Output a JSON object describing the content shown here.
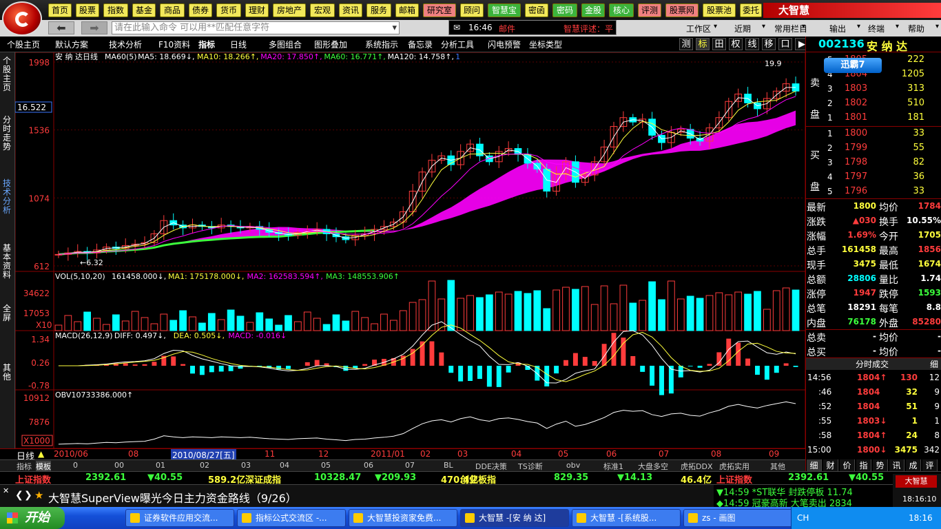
{
  "colors": {
    "red": "#ff3c3c",
    "green": "#3cff3c",
    "yellow": "#ffff3c",
    "white": "#ffffff",
    "cyan": "#00ffff",
    "magenta": "#ff00ff",
    "grid": "#8b0000"
  },
  "nav_buttons": [
    {
      "label": "首页",
      "bg": "#f2e85a",
      "fg": "#000"
    },
    {
      "label": "股票",
      "bg": "#f2e85a",
      "fg": "#000"
    },
    {
      "label": "指数",
      "bg": "#f2e85a",
      "fg": "#000"
    },
    {
      "label": "基金",
      "bg": "#f2e85a",
      "fg": "#000"
    },
    {
      "label": "商品",
      "bg": "#f2e85a",
      "fg": "#000"
    },
    {
      "label": "债券",
      "bg": "#f2e85a",
      "fg": "#000"
    },
    {
      "label": "货币",
      "bg": "#f2e85a",
      "fg": "#000"
    },
    {
      "label": "理财",
      "bg": "#f2e85a",
      "fg": "#000"
    },
    {
      "label": "房地产",
      "bg": "#f2e85a",
      "fg": "#000"
    },
    {
      "label": "宏观",
      "bg": "#f2e85a",
      "fg": "#000"
    },
    {
      "label": "资讯",
      "bg": "#f2e85a",
      "fg": "#000"
    },
    {
      "label": "服务",
      "bg": "#f2e85a",
      "fg": "#000"
    },
    {
      "label": "邮箱",
      "bg": "#f2e85a",
      "fg": "#000"
    },
    {
      "label": "研究室",
      "bg": "#f08080",
      "fg": "#000"
    },
    {
      "label": "顾问",
      "bg": "#f2e85a",
      "fg": "#000"
    },
    {
      "label": "智慧宝",
      "bg": "#3cb43c",
      "fg": "#fff"
    },
    {
      "label": "密函",
      "bg": "#f2e85a",
      "fg": "#000"
    },
    {
      "label": "密码",
      "bg": "#3cb43c",
      "fg": "#fff"
    },
    {
      "label": "金股",
      "bg": "#3cb43c",
      "fg": "#fff"
    },
    {
      "label": "核心",
      "bg": "#3cb43c",
      "fg": "#fff"
    },
    {
      "label": "评测",
      "bg": "#f08080",
      "fg": "#000"
    },
    {
      "label": "股票网",
      "bg": "#f08080",
      "fg": "#000"
    },
    {
      "label": "股票池",
      "bg": "#f2e85a",
      "fg": "#000"
    },
    {
      "label": "委托",
      "bg": "#f2e85a",
      "fg": "#000"
    }
  ],
  "brand": "大智慧",
  "command_placeholder": "请在此输入命令  可以用**匹配任意字符",
  "ticker": {
    "time": "16:46",
    "label": "邮件",
    "message": "智慧评述：平"
  },
  "right_menus": [
    "工作区",
    "近期",
    "常用栏目",
    "输出",
    "终端",
    "帮助"
  ],
  "toolbar": [
    "个股主页",
    "默认方案",
    "技术分析",
    "F10资料",
    "指标",
    "日线",
    "多图组合",
    "图形叠加",
    "系统指示",
    "备忘录",
    "分析工具",
    "闪电预警",
    "坐标类型"
  ],
  "toolbar_right": [
    "测",
    "标",
    "田",
    "权",
    "线",
    "移",
    "口",
    "▶"
  ],
  "left_tabs": [
    "个股主页",
    "分时走势",
    "技术分析",
    "基本资料",
    "全屏",
    "其他"
  ],
  "stock": {
    "code": "002136",
    "name": "安 纳 达"
  },
  "main_chart": {
    "title": "安 纳 达日线",
    "legend": [
      {
        "text": "MA60(5)",
        "color": "#fff"
      },
      {
        "text": "MA5: 18.669↓,",
        "color": "#fff"
      },
      {
        "text": "MA10: 18.266↑,",
        "color": "#ffff3c"
      },
      {
        "text": "MA20: 17.850↑,",
        "color": "#ff00ff"
      },
      {
        "text": "MA60: 16.771↑,",
        "color": "#3cff3c"
      },
      {
        "text": "MA120: 14.758↑,",
        "color": "#fff"
      },
      {
        "text": "1",
        "color": "#3c78ff"
      }
    ],
    "y_labels": [
      "1998",
      "1536",
      "1074",
      "612"
    ],
    "current_label": "16.522",
    "low_label": "6.32",
    "high_label": "19.9"
  },
  "vol_chart": {
    "legend": [
      {
        "text": "VOL(5,10,20)",
        "color": "#fff"
      },
      {
        "text": "161458.000↓,",
        "color": "#fff"
      },
      {
        "text": "MA1: 175178.000↓,",
        "color": "#ffff3c"
      },
      {
        "text": "MA2: 162583.594↑,",
        "color": "#ff00ff"
      },
      {
        "text": "MA3: 148553.906↑",
        "color": "#3cff3c"
      }
    ],
    "y_labels": [
      "34622",
      "17053"
    ],
    "unit": "X10"
  },
  "macd_chart": {
    "legend": [
      {
        "text": "MACD(26,12,9)",
        "color": "#fff"
      },
      {
        "text": "DIFF: 0.497↓,",
        "color": "#fff"
      },
      {
        "text": "DEA: 0.505↓,",
        "color": "#ffff3c"
      },
      {
        "text": "MACD: -0.016↓",
        "color": "#ff00ff"
      }
    ],
    "y_labels": [
      "1.34",
      "0.26",
      "-0.78"
    ]
  },
  "obv_chart": {
    "legend": [
      {
        "text": "OBV",
        "color": "#fff"
      },
      {
        "text": "10733386.000↑",
        "color": "#fff"
      }
    ],
    "y_labels": [
      "10912",
      "7876"
    ],
    "unit": "X1000"
  },
  "time_axis": {
    "label": "日线",
    "items": [
      "2010/06",
      "08",
      "2010/08/27[五]",
      "11",
      "12",
      "2011/01",
      "02",
      "03",
      "04",
      "05",
      "06",
      "07",
      "08",
      "09"
    ]
  },
  "bottom_tabs": [
    "指标",
    "模板",
    "0",
    "00",
    "01",
    "02",
    "03",
    "04",
    "05",
    "06",
    "07",
    "BL",
    "DDE决策",
    "TS诊断",
    "obv",
    "标准1",
    "大盘多空",
    "虎拓DDX",
    "虎拓实用",
    "其他"
  ],
  "order_book": {
    "sell_label": "卖盘",
    "buy_label": "买盘",
    "app_label": "迅霸7",
    "sell": [
      {
        "n": "5",
        "price": "1805",
        "vol": "222"
      },
      {
        "n": "4",
        "price": "1804",
        "vol": "1205"
      },
      {
        "n": "3",
        "price": "1803",
        "vol": "313"
      },
      {
        "n": "2",
        "price": "1802",
        "vol": "510"
      },
      {
        "n": "1",
        "price": "1801",
        "vol": "181"
      }
    ],
    "buy": [
      {
        "n": "1",
        "price": "1800",
        "vol": "33"
      },
      {
        "n": "2",
        "price": "1799",
        "vol": "55"
      },
      {
        "n": "3",
        "price": "1798",
        "vol": "82"
      },
      {
        "n": "4",
        "price": "1797",
        "vol": "36"
      },
      {
        "n": "5",
        "price": "1796",
        "vol": "33"
      }
    ]
  },
  "quote": [
    {
      "l1": "最新",
      "v1": "1800",
      "c1": "#ffff3c",
      "l2": "均价",
      "v2": "1784",
      "c2": "#ff3c3c"
    },
    {
      "l1": "涨跌",
      "v1": "▲030",
      "c1": "#ff3c3c",
      "l2": "换手",
      "v2": "10.55%",
      "c2": "#fff"
    },
    {
      "l1": "涨幅",
      "v1": "1.69%",
      "c1": "#ff3c3c",
      "l2": "今开",
      "v2": "1705",
      "c2": "#ffff3c"
    },
    {
      "l1": "总手",
      "v1": "161458",
      "c1": "#ffff3c",
      "l2": "最高",
      "v2": "1856",
      "c2": "#ff3c3c"
    },
    {
      "l1": "现手",
      "v1": "3475",
      "c1": "#ffff3c",
      "l2": "最低",
      "v2": "1674",
      "c2": "#ffff3c"
    },
    {
      "l1": "总额",
      "v1": "28806",
      "c1": "#00ffff",
      "l2": "量比",
      "v2": "1.74",
      "c2": "#fff"
    },
    {
      "l1": "涨停",
      "v1": "1947",
      "c1": "#ff3c3c",
      "l2": "跌停",
      "v2": "1593",
      "c2": "#3cff3c"
    },
    {
      "l1": "总笔",
      "v1": "18291",
      "c1": "#fff",
      "l2": "每笔",
      "v2": "8.8",
      "c2": "#fff"
    },
    {
      "l1": "内盘",
      "v1": "76178",
      "c1": "#3cff3c",
      "l2": "外盘",
      "v2": "85280",
      "c2": "#ff3c3c"
    },
    {
      "l1": "总卖",
      "v1": "-",
      "c1": "#fff",
      "l2": "均价",
      "v2": "-",
      "c2": "#fff"
    },
    {
      "l1": "总买",
      "v1": "-",
      "c1": "#fff",
      "l2": "均价",
      "v2": "-",
      "c2": "#fff"
    }
  ],
  "trades_header": {
    "title": "分时成交",
    "extra": "细"
  },
  "trades": [
    {
      "time": "14:56",
      "price": "1804↑",
      "vol": "130",
      "n": "12",
      "pc": "#ff3c3c",
      "vc": "#ff3c3c"
    },
    {
      "time": ":46",
      "price": "1804",
      "vol": "32",
      "n": "9",
      "pc": "#ff3c3c",
      "vc": "#ffff3c"
    },
    {
      "time": ":52",
      "price": "1804",
      "vol": "51",
      "n": "9",
      "pc": "#ff3c3c",
      "vc": "#ffff3c"
    },
    {
      "time": ":55",
      "price": "1803↓",
      "vol": "1",
      "n": "1",
      "pc": "#ff3c3c",
      "vc": "#ffff3c"
    },
    {
      "time": ":58",
      "price": "1804↑",
      "vol": "24",
      "n": "8",
      "pc": "#ff3c3c",
      "vc": "#ffff3c"
    },
    {
      "time": "15:00",
      "price": "1800↓",
      "vol": "3475",
      "n": "342",
      "pc": "#ff3c3c",
      "vc": "#ffff3c"
    }
  ],
  "right_tabs": [
    "细",
    "财",
    "价",
    "指",
    "势",
    "讯",
    "成",
    "评"
  ],
  "index_bar": [
    {
      "text": "上证指数",
      "color": "#ff3c3c"
    },
    {
      "text": "2392.61",
      "color": "#3cff3c"
    },
    {
      "text": "▼40.55",
      "color": "#3cff3c"
    },
    {
      "text": "589.2亿",
      "color": "#ffff3c"
    },
    {
      "text": "深证成指",
      "color": "#ffff3c"
    },
    {
      "text": "10328.47",
      "color": "#3cff3c"
    },
    {
      "text": "▼209.93",
      "color": "#3cff3c"
    },
    {
      "text": "470.4亿",
      "color": "#ffff3c"
    },
    {
      "text": "创业板指",
      "color": "#ffff3c"
    },
    {
      "text": "829.35",
      "color": "#3cff3c"
    },
    {
      "text": "▼14.13",
      "color": "#3cff3c"
    },
    {
      "text": "46.4亿",
      "color": "#ffff3c"
    }
  ],
  "index_bar_right": [
    {
      "text": "上证指数",
      "color": "#ff3c3c"
    },
    {
      "text": "2392.61",
      "color": "#3cff3c"
    },
    {
      "text": "▼40.55",
      "color": "#3cff3c"
    }
  ],
  "news": "大智慧SuperView曝光今日主力资金路线（9/26）",
  "alerts": [
    {
      "text": "▼14:59 *ST联华  封跌停板 11.74",
      "color": "#3cff3c"
    },
    {
      "text": "◆14:59 冠豪高新 大笔卖出 2834",
      "color": "#3cff3c"
    }
  ],
  "clock": "18:16:10",
  "taskbar": {
    "start": "开始",
    "items": [
      "证券软件应用交流...",
      "指标公式交流区 -...",
      "大智慧投资家免费...",
      "大智慧 -[安 纳 达]",
      "大智慧 -[系统股...",
      "zs - 画图"
    ],
    "tray_lang": "CH",
    "time": "18:16"
  },
  "chart_data": {
    "type": "candlestick",
    "title": "安 纳 达日线",
    "y_range": [
      6.12,
      19.98
    ],
    "y_ticks": [
      19.98,
      15.36,
      10.74,
      6.12
    ],
    "close": [
      6.9,
      7.0,
      7.1,
      7.0,
      7.2,
      7.4,
      7.3,
      7.5,
      7.6,
      7.7,
      8.3,
      9.2,
      8.9,
      8.7,
      8.9,
      8.8,
      8.7,
      8.9,
      8.8,
      8.7,
      8.8,
      8.6,
      8.4,
      8.3,
      8.2,
      8.4,
      8.5,
      8.6,
      8.3,
      8.1,
      7.9,
      8.2,
      8.3,
      8.6,
      8.8,
      9.1,
      9.8,
      11.2,
      12.5,
      13.3,
      13.6,
      13.0,
      13.9,
      14.4,
      13.6,
      13.2,
      13.9,
      14.1,
      13.7,
      13.1,
      12.7,
      11.2,
      12.4,
      13.2,
      11.8,
      12.3,
      13.2,
      14.2,
      15.6,
      16.2,
      15.9,
      16.1,
      15.0,
      14.5,
      15.2,
      15.4,
      14.8,
      14.6,
      15.5,
      16.2,
      17.3,
      17.8,
      17.2,
      16.8,
      17.5,
      18.0,
      18.5,
      18.0
    ]
  }
}
